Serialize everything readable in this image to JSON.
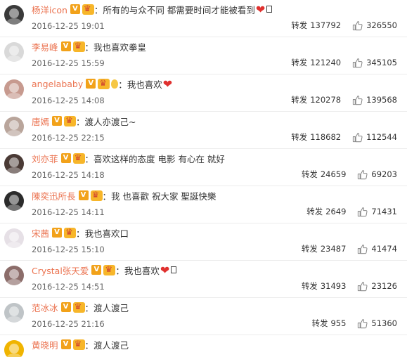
{
  "comments": [
    {
      "user": "杨洋icon",
      "text": "：所有的与众不同 都需要时间才能被看到",
      "time": "2016-12-25 19:01",
      "repost_label": "转发",
      "reposts": "137792",
      "likes": "326550",
      "avatar_color": "#3a3a3a",
      "badges": [
        "v",
        "crown"
      ],
      "tail": [
        "heart",
        "box"
      ]
    },
    {
      "user": "李易峰",
      "text": "：我也喜欢拳皇",
      "time": "2016-12-25 15:59",
      "repost_label": "转发",
      "reposts": "121240",
      "likes": "345105",
      "avatar_color": "#d9d9d9",
      "badges": [
        "v",
        "crown"
      ],
      "tail": []
    },
    {
      "user": "angelababy",
      "text": "：我也喜欢",
      "time": "2016-12-25 14:08",
      "repost_label": "转发",
      "reposts": "120278",
      "likes": "139568",
      "avatar_color": "#c79a8f",
      "badges": [
        "v",
        "crown",
        "balloon"
      ],
      "tail": [
        "heart"
      ]
    },
    {
      "user": "唐嫣",
      "text": "：渡人亦渡己~",
      "time": "2016-12-25 22:15",
      "repost_label": "转发",
      "reposts": "118682",
      "likes": "112544",
      "avatar_color": "#b9a59b",
      "badges": [
        "v",
        "crown"
      ],
      "tail": []
    },
    {
      "user": "刘亦菲",
      "text": "：喜欢这样的态度 电影 有心在 就好",
      "time": "2016-12-25 14:18",
      "repost_label": "转发",
      "reposts": "24659",
      "likes": "69203",
      "avatar_color": "#4a3a35",
      "badges": [
        "v",
        "crown"
      ],
      "tail": []
    },
    {
      "user": "陳奕迅所長",
      "text": "：我  也喜歡 祝大家 聖誕快樂",
      "time": "2016-12-25 14:11",
      "repost_label": "转发",
      "reposts": "2649",
      "likes": "71431",
      "avatar_color": "#2b2b2b",
      "badges": [
        "v",
        "crown"
      ],
      "tail": []
    },
    {
      "user": "宋茜",
      "text": "：我也喜欢口",
      "time": "2016-12-25 15:10",
      "repost_label": "转发",
      "reposts": "23487",
      "likes": "41474",
      "avatar_color": "#e6e0e6",
      "badges": [
        "v",
        "crown"
      ],
      "tail": []
    },
    {
      "user": "Crystal张天爱",
      "text": "：我也喜欢",
      "time": "2016-12-25 14:51",
      "repost_label": "转发",
      "reposts": "31493",
      "likes": "23126",
      "avatar_color": "#8c6d6a",
      "badges": [
        "v",
        "crown"
      ],
      "tail": [
        "heart",
        "box"
      ]
    },
    {
      "user": "范冰冰",
      "text": "：渡人渡己",
      "time": "2016-12-25 21:16",
      "repost_label": "转发",
      "reposts": "955",
      "likes": "51360",
      "avatar_color": "#bfc4c7",
      "badges": [
        "v",
        "crown"
      ],
      "tail": []
    },
    {
      "user": "黄晓明",
      "text": "：渡人渡己",
      "time": "",
      "repost_label": "",
      "reposts": "",
      "likes": "",
      "avatar_color": "#f0b400",
      "badges": [
        "v",
        "crown"
      ],
      "tail": []
    }
  ],
  "colors": {
    "username": "#eb7350",
    "v_badge": "#f2a21a",
    "heart": "#e0312f"
  },
  "icons": {
    "like": "thumbs-up-icon",
    "verified": "verified-v-icon",
    "member": "crown-icon",
    "heart": "heart-icon"
  }
}
